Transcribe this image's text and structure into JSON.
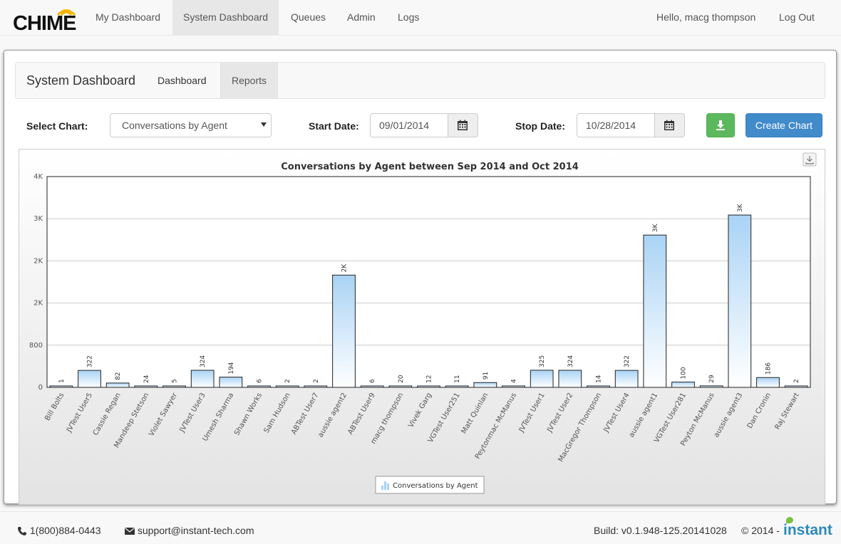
{
  "app": {
    "logo_text": "CHIME",
    "nav": [
      "My Dashboard",
      "System Dashboard",
      "Queues",
      "Admin",
      "Logs"
    ],
    "active_nav": "System Dashboard",
    "greeting": "Hello, macg thompson",
    "logout": "Log Out"
  },
  "subnav": {
    "brand": "System Dashboard",
    "tabs": [
      "Dashboard",
      "Reports"
    ],
    "active_tab": "Reports"
  },
  "controls": {
    "select_chart_label": "Select Chart:",
    "select_chart_value": "Conversations by Agent",
    "start_date_label": "Start Date:",
    "start_date_value": "09/01/2014",
    "stop_date_label": "Stop Date:",
    "stop_date_value": "10/28/2014",
    "create_chart_label": "Create Chart"
  },
  "chart_data": {
    "type": "bar",
    "title": "Conversations by Agent between Sep 2014 and Oct 2014",
    "categories": [
      "Bill Bolts",
      "JVTest User5",
      "Cassie Regan",
      "Mandeep Stetson",
      "Violet Sawyer",
      "JVTest User3",
      "Umesh Sharma",
      "Shawn Works",
      "Sam Hudson",
      "ABTest User7",
      "aussie agent2",
      "ABTest User9",
      "macg thompson",
      "Vivek Garg",
      "VGTest User251",
      "Matt Quinlan",
      "Peytonmac McManus",
      "JVTest User1",
      "JVTest User2",
      "MacGregor Thompson",
      "JVTest User4",
      "aussie agent1",
      "VGTest User281",
      "Peyton McManus",
      "aussie agent3",
      "Dan Cronin",
      "Raj Stewart"
    ],
    "values": [
      1,
      322,
      82,
      24,
      5,
      324,
      194,
      6,
      2,
      2,
      2130,
      6,
      20,
      12,
      11,
      91,
      4,
      325,
      324,
      14,
      322,
      2890,
      100,
      29,
      3270,
      186,
      2
    ],
    "labels": [
      "1",
      "322",
      "82",
      "24",
      "5",
      "324",
      "194",
      "6",
      "2",
      "2",
      "2K",
      "6",
      "20",
      "12",
      "11",
      "91",
      "4",
      "325",
      "324",
      "14",
      "322",
      "3K",
      "100",
      "29",
      "3K",
      "186",
      "2"
    ],
    "y_ticks": [
      0,
      800,
      1600,
      2400,
      3200,
      4000
    ],
    "y_tick_labels": [
      "0",
      "800",
      "2K",
      "2K",
      "3K",
      "4K"
    ],
    "ylim": [
      0,
      4000
    ],
    "grid": true,
    "legend": [
      "Conversations by Agent"
    ],
    "legend_position": "bottom-center"
  },
  "footer": {
    "phone": "1(800)884-0443",
    "email": "support@instant-tech.com",
    "build": "Build: v0.1.948-125.20141028",
    "copyright": "© 2014 -",
    "brand": "instant"
  },
  "colors": {
    "primary": "#428bca",
    "success": "#5cb85c",
    "bar_top": "#a9d3f5",
    "bar_bottom": "#ffffff",
    "brand_blue": "#2a8bbd",
    "brand_green": "#7bc143"
  }
}
